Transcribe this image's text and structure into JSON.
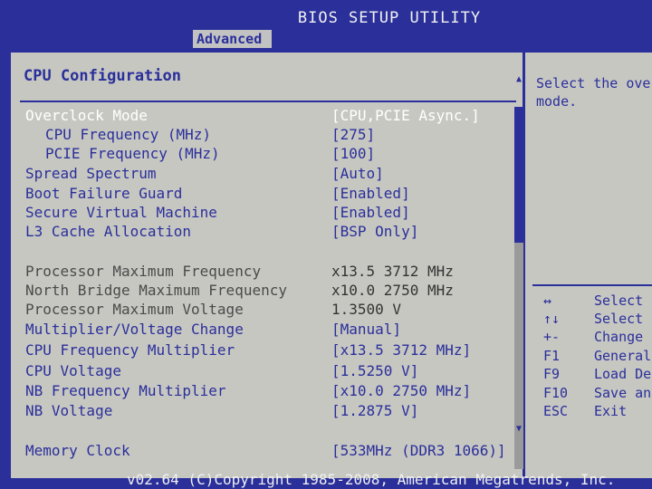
{
  "header": {
    "title": "BIOS SETUP UTILITY",
    "active_tab": "Advanced"
  },
  "section": {
    "title": "CPU Configuration"
  },
  "items": [
    {
      "label": "Overclock Mode",
      "value": "[CPU,PCIE Async.]",
      "state": "selected"
    },
    {
      "label": "CPU Frequency (MHz)",
      "value": "[275]",
      "state": "option"
    },
    {
      "label": "PCIE Frequency (MHz)",
      "value": "[100]",
      "state": "option"
    },
    {
      "label": "Spread Spectrum",
      "value": "[Auto]",
      "state": "option"
    },
    {
      "label": "Boot Failure Guard",
      "value": "[Enabled]",
      "state": "option"
    },
    {
      "label": "Secure Virtual Machine",
      "value": "[Enabled]",
      "state": "option"
    },
    {
      "label": "L3 Cache Allocation",
      "value": "[BSP Only]",
      "state": "option"
    },
    {
      "label": "Processor Maximum Frequency",
      "value": "x13.5 3712 MHz",
      "state": "info"
    },
    {
      "label": "North Bridge Maximum Frequency",
      "value": "x10.0 2750 MHz",
      "state": "info"
    },
    {
      "label": "Processor Maximum Voltage",
      "value": "1.3500 V",
      "state": "info"
    },
    {
      "label": "Multiplier/Voltage Change",
      "value": "[Manual]",
      "state": "option"
    },
    {
      "label": "CPU Frequency Multiplier",
      "value": "[x13.5 3712 MHz]",
      "state": "option"
    },
    {
      "label": "CPU Voltage",
      "value": "[1.5250 V]",
      "state": "option"
    },
    {
      "label": "NB Frequency Multiplier",
      "value": "[x10.0 2750 MHz]",
      "state": "option"
    },
    {
      "label": "NB Voltage",
      "value": "[1.2875 V]",
      "state": "option"
    },
    {
      "label": "Memory Clock",
      "value": "[533MHz (DDR3 1066)]",
      "state": "option"
    }
  ],
  "help": {
    "text": "Select the ove\nmode."
  },
  "keys": [
    {
      "key": "↔",
      "desc": "Select"
    },
    {
      "key": "↑↓",
      "desc": "Select"
    },
    {
      "key": "+-",
      "desc": "Change"
    },
    {
      "key": "F1",
      "desc": "General"
    },
    {
      "key": "F9",
      "desc": "Load De"
    },
    {
      "key": "F10",
      "desc": "Save an"
    },
    {
      "key": "ESC",
      "desc": "Exit"
    }
  ],
  "footer": {
    "text": "v02.64 (C)Copyright 1985-2008, American Megatrends, Inc."
  }
}
